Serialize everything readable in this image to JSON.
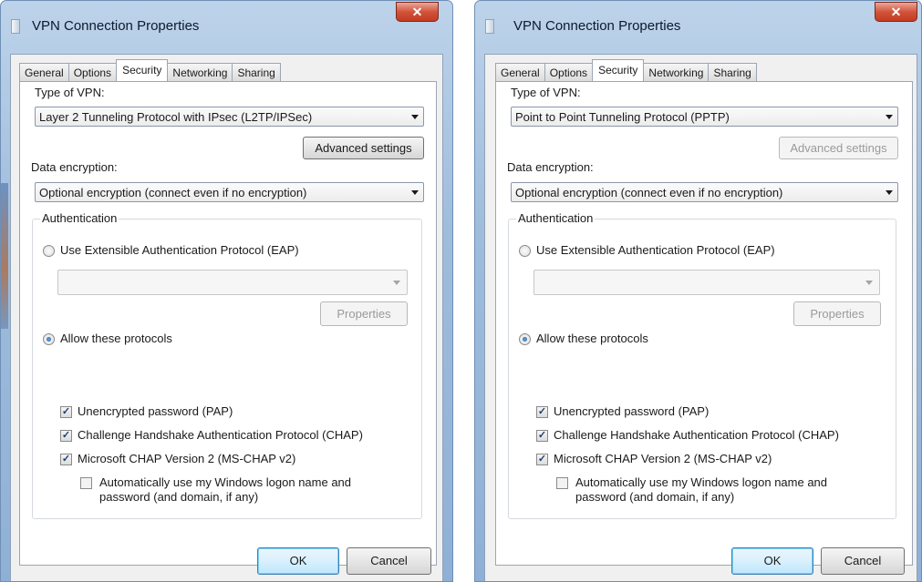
{
  "dialogs": [
    {
      "title": "VPN Connection Properties",
      "close_glyph": "✕",
      "tabs": [
        "General",
        "Options",
        "Security",
        "Networking",
        "Sharing"
      ],
      "vpn_type_label": "Type of VPN:",
      "vpn_type_value": "Layer 2 Tunneling Protocol with IPsec (L2TP/IPSec)",
      "advanced_settings": "Advanced settings",
      "data_encryption_label": "Data encryption:",
      "data_encryption_value": "Optional encryption (connect even if no encryption)",
      "authentication_label": "Authentication",
      "use_eap_label": "Use Extensible Authentication Protocol (EAP)",
      "properties_label": "Properties",
      "allow_protocols_label": "Allow these protocols",
      "pap_label": "Unencrypted password (PAP)",
      "chap_label": "Challenge Handshake Authentication Protocol (CHAP)",
      "mschap_label": "Microsoft CHAP Version 2 (MS-CHAP v2)",
      "auto_logon_line1": "Automatically use my Windows logon name and",
      "auto_logon_line2": "password (and domain, if any)",
      "ok": "OK",
      "cancel": "Cancel",
      "check_glyph": "✓"
    },
    {
      "title": "VPN Connection Properties",
      "close_glyph": "✕",
      "tabs": [
        "General",
        "Options",
        "Security",
        "Networking",
        "Sharing"
      ],
      "vpn_type_label": "Type of VPN:",
      "vpn_type_value": "Point to Point Tunneling Protocol (PPTP)",
      "advanced_settings": "Advanced settings",
      "data_encryption_label": "Data encryption:",
      "data_encryption_value": "Optional encryption (connect even if no encryption)",
      "authentication_label": "Authentication",
      "use_eap_label": "Use Extensible Authentication Protocol (EAP)",
      "properties_label": "Properties",
      "allow_protocols_label": "Allow these protocols",
      "pap_label": "Unencrypted password (PAP)",
      "chap_label": "Challenge Handshake Authentication Protocol (CHAP)",
      "mschap_label": "Microsoft CHAP Version 2 (MS-CHAP v2)",
      "auto_logon_line1": "Automatically use my Windows logon name and",
      "auto_logon_line2": "password (and domain, if any)",
      "ok": "OK",
      "cancel": "Cancel",
      "check_glyph": "✓"
    }
  ],
  "colors": {
    "titlebar": "#9fbcdc",
    "close_button": "#c23b22",
    "ok_button": "#bee6fd",
    "window_background": "#f0f0f0"
  }
}
